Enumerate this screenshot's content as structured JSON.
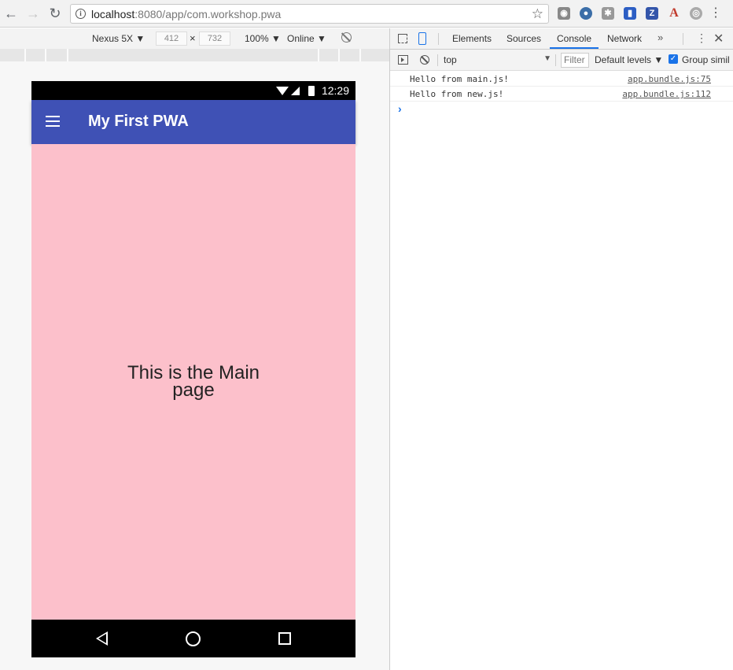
{
  "browser": {
    "url_host": "localhost",
    "url_rest": ":8080/app/com.workshop.pwa"
  },
  "device_toolbar": {
    "device": "Nexus 5X",
    "width": "412",
    "times": "×",
    "height": "732",
    "zoom": "100%",
    "network": "Online"
  },
  "phone": {
    "time": "12:29",
    "app_title": "My First PWA",
    "main_line1": "This is the Main",
    "main_line2": "page"
  },
  "devtools": {
    "tabs": [
      "Elements",
      "Sources",
      "Console",
      "Network"
    ],
    "active_tab": "Console",
    "more": "»",
    "context": "top",
    "filter_placeholder": "Filter",
    "levels": "Default levels ▼",
    "group_label": "Group simil",
    "messages": [
      {
        "text": "Hello from main.js!",
        "source": "app.bundle.js:75"
      },
      {
        "text": "Hello from new.js!",
        "source": "app.bundle.js:112"
      }
    ],
    "prompt": "›"
  },
  "colors": {
    "app_bar": "#3f51b5",
    "content_bg": "#fcc0cb",
    "accent": "#1a73e8"
  }
}
